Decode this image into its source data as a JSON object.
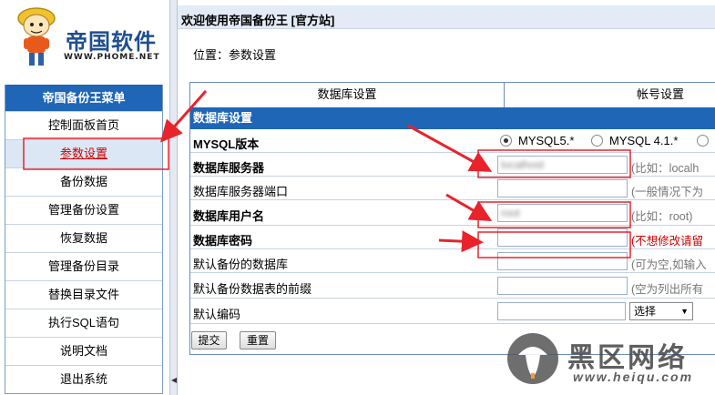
{
  "logo": {
    "brand": "帝国软件",
    "url": "WWW.PHOME.NET"
  },
  "menu": {
    "title": "帝国备份王菜单",
    "items": [
      {
        "label": "控制面板首页"
      },
      {
        "label": "参数设置"
      },
      {
        "label": "备份数据"
      },
      {
        "label": "管理备份设置"
      },
      {
        "label": "恢复数据"
      },
      {
        "label": "管理备份目录"
      },
      {
        "label": "替换目录文件"
      },
      {
        "label": "执行SQL语句"
      },
      {
        "label": "说明文档"
      },
      {
        "label": "退出系统"
      }
    ]
  },
  "header": {
    "welcome": "欢迎使用帝国备份王 [官方站]"
  },
  "location": "位置：参数设置",
  "tabs": [
    {
      "label": "数据库设置"
    },
    {
      "label": "帐号设置"
    }
  ],
  "section_title": "数据库设置",
  "form": {
    "mysql_version": {
      "label": "MYSQL版本",
      "options": [
        "MYSQL5.*",
        "MYSQL 4.1.*"
      ],
      "selected": "MYSQL5.*"
    },
    "db_server": {
      "label": "数据库服务器",
      "value": "localhost",
      "hint": "(比如：localh"
    },
    "db_port": {
      "label": "数据库服务器端口",
      "value": "",
      "hint": "(一般情况下为"
    },
    "db_user": {
      "label": "数据库用户名",
      "value": "root",
      "hint": "(比如：root)"
    },
    "db_password": {
      "label": "数据库密码",
      "value": "",
      "hint": "(不想修改请留"
    },
    "default_db": {
      "label": "默认备份的数据库",
      "value": "",
      "hint": "(可为空,如输入"
    },
    "default_prefix": {
      "label": "默认备份数据表的前缀",
      "value": "",
      "hint": "(空为列出所有"
    },
    "default_charset": {
      "label": "默认编码",
      "value": "",
      "select": "选择"
    }
  },
  "buttons": {
    "submit": "提交",
    "reset": "重置"
  },
  "watermark": {
    "text": "黑区网络",
    "url": "www.heiqu.com"
  },
  "colors": {
    "menu_header": "#1f66b7",
    "topbar": "#e3ebf6",
    "annotation": "#e8232b",
    "hint_red": "#d00000"
  }
}
